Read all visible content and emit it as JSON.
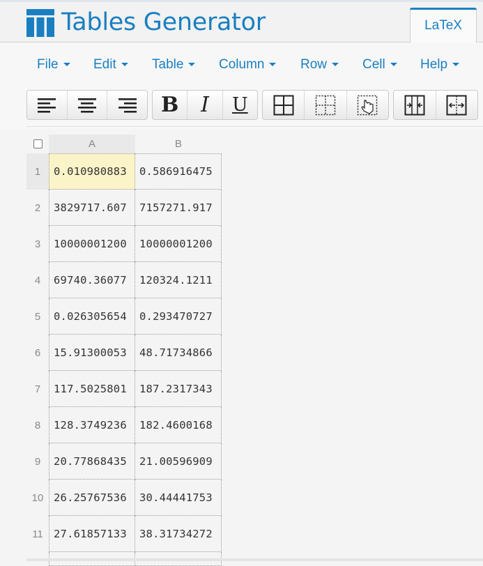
{
  "app": {
    "title": "Tables Generator",
    "active_tab": "LaTeX",
    "brand_color": "#1a7fc1"
  },
  "menu": [
    {
      "label": "File",
      "icon": "caret-down-icon"
    },
    {
      "label": "Edit",
      "icon": "caret-down-icon"
    },
    {
      "label": "Table",
      "icon": "caret-down-icon"
    },
    {
      "label": "Column",
      "icon": "caret-down-icon"
    },
    {
      "label": "Row",
      "icon": "caret-down-icon"
    },
    {
      "label": "Cell",
      "icon": "caret-down-icon"
    },
    {
      "label": "Help",
      "icon": "caret-down-icon"
    }
  ],
  "toolbar": {
    "align": [
      "align-left-icon",
      "align-center-icon",
      "align-right-icon"
    ],
    "format": {
      "bold": "B",
      "italic": "I",
      "underline": "U"
    },
    "borders": [
      "all-borders-icon",
      "inner-borders-icon",
      "border-cursor-icon"
    ],
    "merge": [
      "merge-cells-icon",
      "split-cells-icon"
    ]
  },
  "grid": {
    "columns": [
      "A",
      "B"
    ],
    "rows": [
      {
        "num": "1",
        "a": "0.010980883",
        "b": "0.586916475"
      },
      {
        "num": "2",
        "a": "3829717.607",
        "b": "7157271.917"
      },
      {
        "num": "3",
        "a": "10000001200",
        "b": "10000001200"
      },
      {
        "num": "4",
        "a": "69740.36077",
        "b": "120324.1211"
      },
      {
        "num": "5",
        "a": "0.026305654",
        "b": "0.293470727"
      },
      {
        "num": "6",
        "a": "15.91300053",
        "b": "48.71734866"
      },
      {
        "num": "7",
        "a": "117.5025801",
        "b": "187.2317343"
      },
      {
        "num": "8",
        "a": "128.3749236",
        "b": "182.4600168"
      },
      {
        "num": "9",
        "a": "20.77868435",
        "b": "21.00596909"
      },
      {
        "num": "10",
        "a": "26.25767536",
        "b": "30.44441753"
      },
      {
        "num": "11",
        "a": "27.61857133",
        "b": "38.31734272"
      }
    ],
    "selected_cell": "A1",
    "selected_color": "#fbf4c8"
  }
}
